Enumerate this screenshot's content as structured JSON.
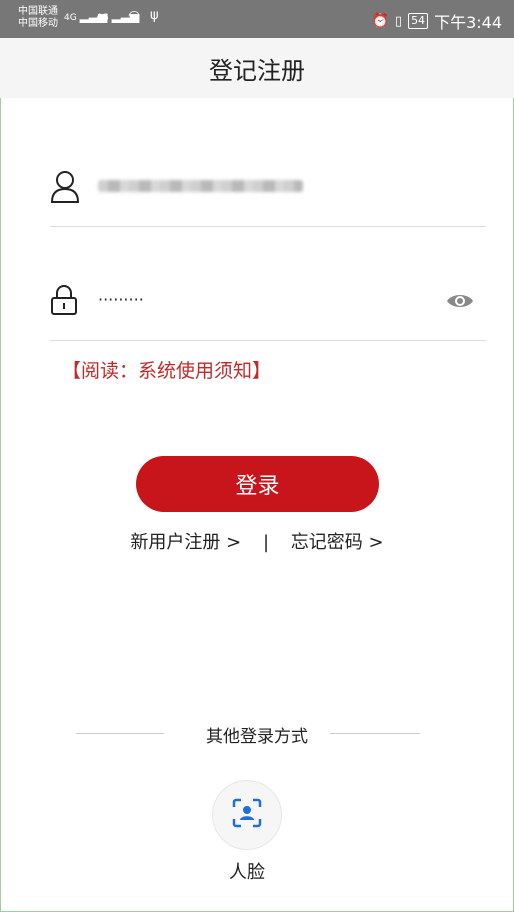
{
  "status_bar": {
    "carrier1": "中国联通",
    "carrier2": "中国移动",
    "sig1": "4G",
    "sig2": "4G",
    "battery": "54",
    "time": "下午3:44"
  },
  "header": {
    "title": "登记注册"
  },
  "login": {
    "password_mask": "·········",
    "notice": "【阅读：系统使用须知】",
    "login_button": "登录",
    "register_link": "新用户注册 >",
    "separator": "|",
    "forgot_link": "忘记密码 >"
  },
  "other_login": {
    "title": "其他登录方式",
    "face_label": "人脸"
  },
  "icons": {
    "user": "user-icon",
    "lock": "lock-icon",
    "eye": "eye-icon",
    "face": "face-scan-icon"
  },
  "colors": {
    "accent": "#c8151b",
    "notice": "#c12a28",
    "face_icon": "#1f6fd6"
  }
}
